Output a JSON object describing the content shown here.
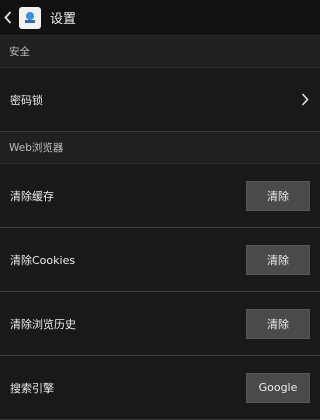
{
  "header": {
    "title": "设置",
    "icon_name": "app-logo-icon"
  },
  "sections": [
    {
      "header": "安全",
      "rows": [
        {
          "label": "密码锁",
          "control": "chevron"
        }
      ]
    },
    {
      "header": "Web浏览器",
      "rows": [
        {
          "label": "清除缓存",
          "button": "清除"
        },
        {
          "label": "清除Cookies",
          "button": "清除"
        },
        {
          "label": "清除浏览历史",
          "button": "清除"
        },
        {
          "label": "搜索引擎",
          "button": "Google"
        }
      ]
    }
  ],
  "colors": {
    "background": "#191919",
    "topbar": "#111111",
    "section_header": "#202020",
    "button": "#4a4a4a",
    "divider": "#3a3a3a"
  }
}
